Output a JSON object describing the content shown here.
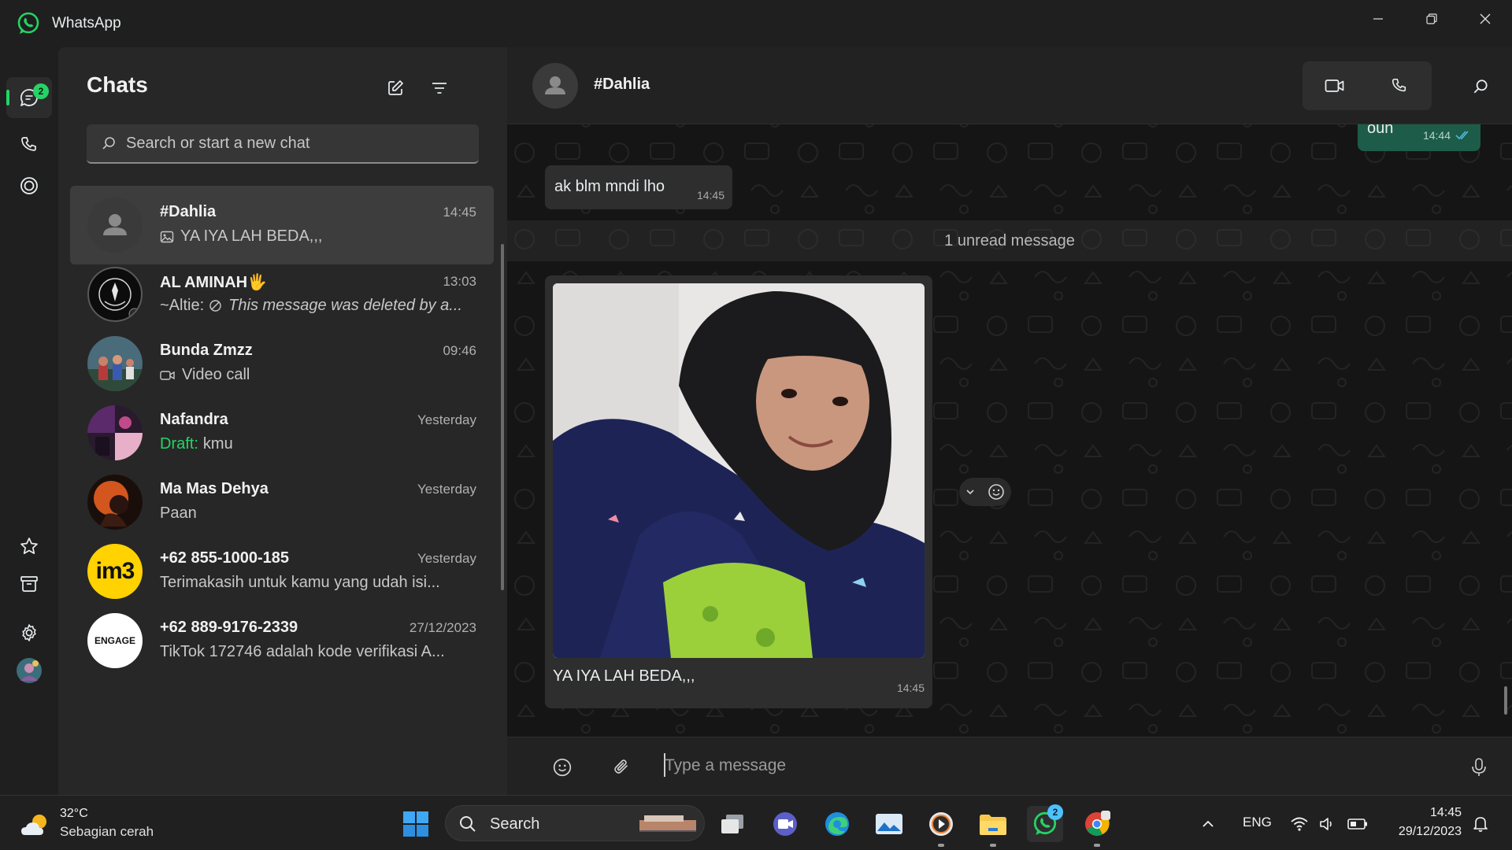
{
  "app": {
    "title": "WhatsApp"
  },
  "rail": {
    "chats_badge": "2"
  },
  "chat_list": {
    "title": "Chats",
    "search_placeholder": "Search or start a new chat",
    "items": [
      {
        "name": "#Dahlia",
        "time": "14:45",
        "preview": "YA IYA LAH BEDA,,,",
        "preview_icon": "photo-icon"
      },
      {
        "name": "AL AMINAH🖐",
        "time": "13:03",
        "preview_sender": "~Altie:",
        "preview": "This message was deleted by a...",
        "preview_icon": "blocked-icon"
      },
      {
        "name": "Bunda Zmzz",
        "time": "09:46",
        "preview": "Video call",
        "preview_icon": "video-icon"
      },
      {
        "name": "Nafandra",
        "time": "Yesterday",
        "draft_label": "Draft:",
        "preview": "kmu"
      },
      {
        "name": "Ma Mas Dehya",
        "time": "Yesterday",
        "preview": "Paan"
      },
      {
        "name": "+62 855-1000-185",
        "time": "Yesterday",
        "preview": "Terimakasih untuk kamu yang udah isi..."
      },
      {
        "name": "+62 889-9176-2339",
        "time": "27/12/2023",
        "preview": "TikTok 172746 adalah kode verifikasi A..."
      }
    ],
    "avatar_labels": {
      "im3": "im3",
      "engage": "ENGAGE"
    }
  },
  "conversation": {
    "name": "#Dahlia",
    "messages": [
      {
        "direction": "out",
        "text": "oun",
        "time": "14:44"
      },
      {
        "direction": "in",
        "text": "ak blm mndi lho",
        "time": "14:45"
      }
    ],
    "unread_label": "1 unread message",
    "image_message": {
      "caption": "YA IYA LAH BEDA,,,",
      "time": "14:45"
    },
    "composer_placeholder": "Type a message"
  },
  "taskbar": {
    "weather_temp": "32°C",
    "weather_desc": "Sebagian cerah",
    "search_label": "Search",
    "whatsapp_badge": "2",
    "language": "ENG",
    "time": "14:45",
    "date": "29/12/2023"
  },
  "colors": {
    "accent": "#25d366",
    "outgoing_bubble": "#1d5c48",
    "incoming_bubble": "#2e2e2e",
    "taskbar_accent": "#4cc2ff"
  }
}
